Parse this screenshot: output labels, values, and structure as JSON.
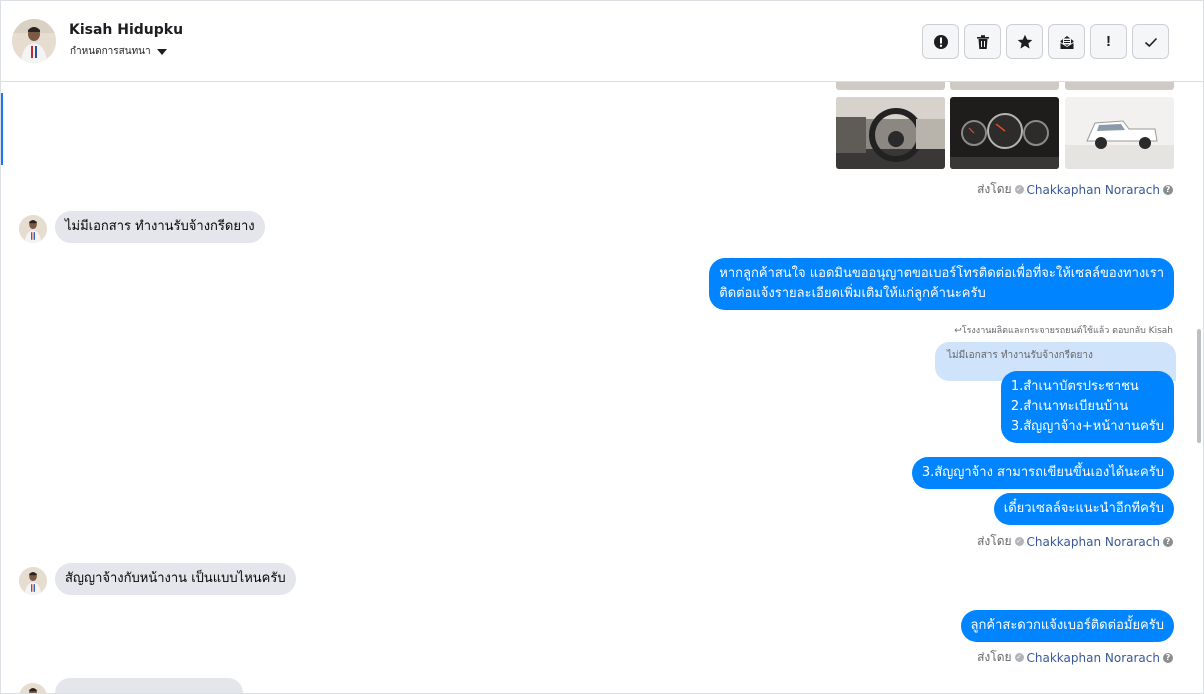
{
  "header": {
    "contact_name": "Kisah Hidupku",
    "conversation_status": "กำหนดการสนทนา",
    "toolbar": [
      {
        "name": "report-spam-button",
        "icon": "alert-circle-icon"
      },
      {
        "name": "delete-button",
        "icon": "trash-icon"
      },
      {
        "name": "star-button",
        "icon": "star-icon"
      },
      {
        "name": "mark-unread-button",
        "icon": "envelope-icon"
      },
      {
        "name": "follow-up-button",
        "icon": "exclamation-icon",
        "label": "!"
      },
      {
        "name": "mark-done-button",
        "icon": "check-icon"
      }
    ]
  },
  "sent_by": {
    "prefix": "ส่งโดย",
    "page_name": "Chakkaphan Norarach",
    "help": "?"
  },
  "messages": {
    "in_1": "ไม่มีเอกสาร ทำงานรับจ้างกรีดยาง",
    "out_1_line1": "หากลูกค้าสนใจ แอดมินขออนุญาตขอเบอร์โทรติดต่อเพื่อที่จะให้เซลล์ของทางเรา",
    "out_1_line2": "ติดต่อแจ้งรายละเอียดเพิ่มเติมให้แก่ลูกค้านะครับ",
    "reply_meta": "โรงงานผลิตและกระจายรถยนต์ใช้แล้ว ตอบกลับ Kisah",
    "quoted": "ไม่มีเอกสาร ทำงานรับจ้างกรีดยาง",
    "out_2_line1": "1.สำเนาบัตรประชาชน",
    "out_2_line2": "2.สำเนาทะเบียนบ้าน",
    "out_2_line3": "3.สัญญาจ้าง+หน้างานครับ",
    "out_3": "3.สัญญาจ้าง สามารถเขียนขึ้นเองได้นะครับ",
    "out_4": "เดี๋ยวเซลล์จะแนะนำอีกทีครับ",
    "in_2": "สัญญาจ้างกับหน้างาน เป็นแบบไหนครับ",
    "out_5": "ลูกค้าสะดวกแจ้งเบอร์ติดต่อมั้ยครับ"
  },
  "colors": {
    "outgoing_bubble": "#0084ff",
    "incoming_bubble": "#e4e6eb",
    "quote_bubble": "#cfe3fb",
    "accent": "#1877f2"
  }
}
